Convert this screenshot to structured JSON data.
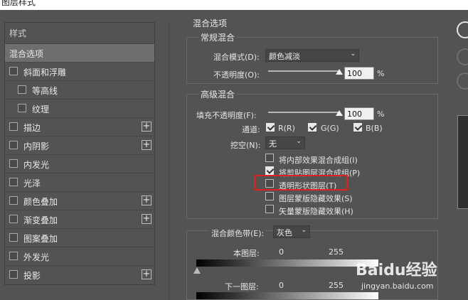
{
  "window": {
    "title": "图层样式"
  },
  "sidebar": {
    "header": "样式",
    "items": [
      {
        "label": "混合选项",
        "checkbox": false,
        "plus": false,
        "indent": 0,
        "selected": true
      },
      {
        "label": "斜面和浮雕",
        "checkbox": true,
        "plus": false,
        "indent": 0
      },
      {
        "label": "等高线",
        "checkbox": true,
        "plus": false,
        "indent": 1
      },
      {
        "label": "纹理",
        "checkbox": true,
        "plus": false,
        "indent": 1
      },
      {
        "label": "描边",
        "checkbox": true,
        "plus": true,
        "indent": 0
      },
      {
        "label": "内阴影",
        "checkbox": true,
        "plus": true,
        "indent": 0
      },
      {
        "label": "内发光",
        "checkbox": true,
        "plus": false,
        "indent": 0
      },
      {
        "label": "光泽",
        "checkbox": true,
        "plus": false,
        "indent": 0
      },
      {
        "label": "颜色叠加",
        "checkbox": true,
        "plus": true,
        "indent": 0
      },
      {
        "label": "渐变叠加",
        "checkbox": true,
        "plus": true,
        "indent": 0
      },
      {
        "label": "图案叠加",
        "checkbox": true,
        "plus": false,
        "indent": 0
      },
      {
        "label": "外发光",
        "checkbox": true,
        "plus": false,
        "indent": 0
      },
      {
        "label": "投影",
        "checkbox": true,
        "plus": true,
        "indent": 0
      }
    ]
  },
  "blend_options": {
    "title": "混合选项",
    "general": {
      "title": "常规混合",
      "mode_label": "混合模式(D):",
      "mode_value": "颜色减淡",
      "opacity_label": "不透明度(O):",
      "opacity_value": "100",
      "opacity_unit": "%",
      "opacity_fraction": 1.0
    },
    "advanced": {
      "title": "高级混合",
      "fill_label": "填充不透明度(F):",
      "fill_value": "100",
      "fill_unit": "%",
      "fill_fraction": 1.0,
      "channels_label": "通道:",
      "channels": [
        {
          "label": "R(R)",
          "checked": true
        },
        {
          "label": "G(G)",
          "checked": true
        },
        {
          "label": "B(B)",
          "checked": true
        }
      ],
      "knockout_label": "挖空(N):",
      "knockout_value": "无",
      "options": [
        {
          "label": "将内部效果混合成组(I)",
          "checked": false
        },
        {
          "label": "将剪贴图层混合成组(P)",
          "checked": true
        },
        {
          "label": "透明形状图层(T)",
          "checked": false
        },
        {
          "label": "图层蒙版隐藏效果(S)",
          "checked": false
        },
        {
          "label": "矢量蒙版隐藏效果(H)",
          "checked": false
        }
      ]
    },
    "blend_if": {
      "label": "混合颜色带(E):",
      "value": "灰色",
      "this_layer_label": "本图层:",
      "this_layer_min": "0",
      "this_layer_max": "255",
      "underlying_label": "下一图层:",
      "underlying_min": "0",
      "underlying_max": "255"
    }
  },
  "watermark": {
    "brand": "Baidu经验",
    "url": "jingyan.baidu.com"
  },
  "colors": {
    "panel_bg": "#535353",
    "selected_bg": "#6e6e6e",
    "highlight_border": "#e02020"
  }
}
